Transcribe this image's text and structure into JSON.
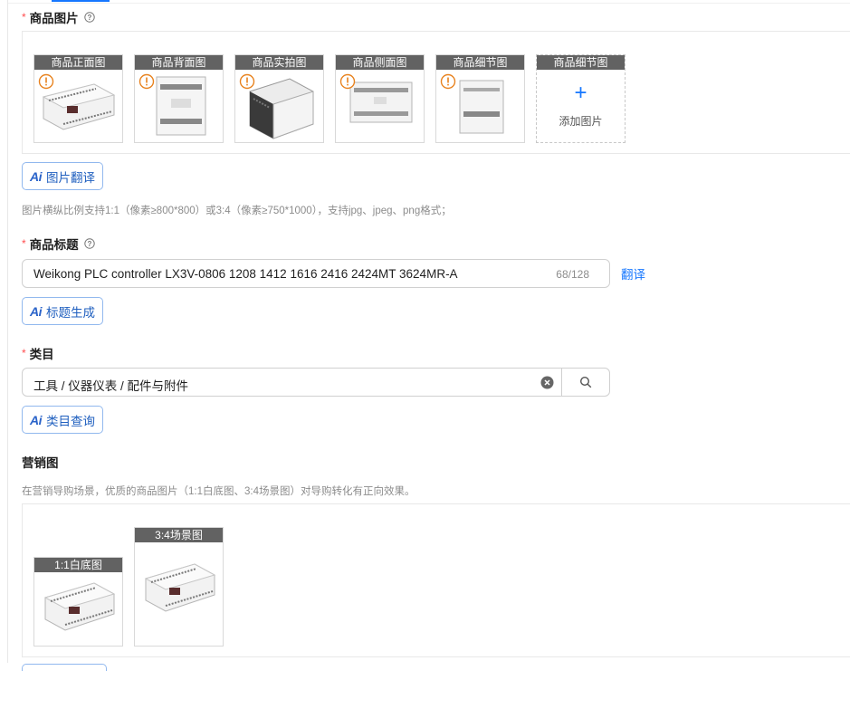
{
  "product_images": {
    "label": "商品图片",
    "thumbs": [
      {
        "caption": "商品正面图"
      },
      {
        "caption": "商品背面图"
      },
      {
        "caption": "商品实拍图"
      },
      {
        "caption": "商品侧面图"
      },
      {
        "caption": "商品细节图"
      }
    ],
    "add_slot": {
      "caption": "商品细节图",
      "add_label": "添加图片"
    },
    "ai_button": "图片翻译",
    "hint": "图片横纵比例支持1:1（像素≥800*800）或3:4（像素≥750*1000），支持jpg、jpeg、png格式；"
  },
  "product_title": {
    "label": "商品标题",
    "value": "Weikong PLC controller LX3V-0806 1208 1412 1616 2416 2424MT 3624MR-A",
    "counter": "68/128",
    "translate_link": "翻译",
    "ai_button": "标题生成"
  },
  "category": {
    "label": "类目",
    "value": "工具 / 仪器仪表 / 配件与附件",
    "ai_button": "类目查询"
  },
  "marketing": {
    "label": "营销图",
    "hint": "在营销导购场景，优质的商品图片（1:1白底图、3:4场景图）对导购转化有正向效果。",
    "thumbs": [
      {
        "caption": "1:1白底图"
      },
      {
        "caption": "3:4场景图"
      }
    ]
  },
  "ai_mark": "Ai",
  "colors": {
    "accent": "#1677ff",
    "required": "#ff4d4f",
    "warning": "#e8821e"
  }
}
